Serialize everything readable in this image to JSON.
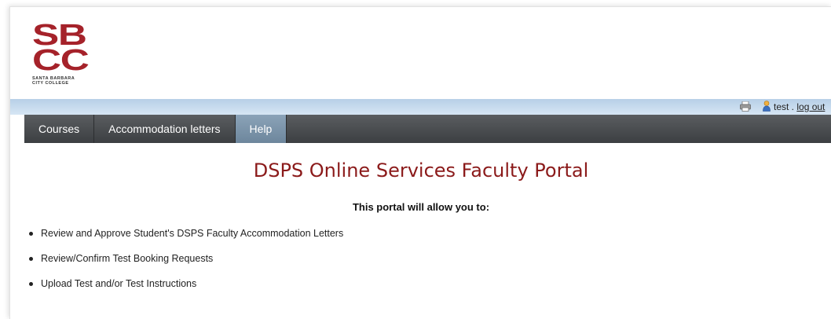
{
  "logo": {
    "line1": "SB",
    "line2": "CC",
    "tagline": "SANTA BARBARA\nCITY COLLEGE",
    "color": "#a5222a"
  },
  "userbar": {
    "print_icon": "printer-icon",
    "user_icon": "user-icon",
    "username": "test",
    "separator": " . ",
    "logout_label": "log out"
  },
  "nav": {
    "items": [
      {
        "label": "Courses",
        "active": false
      },
      {
        "label": "Accommodation letters",
        "active": false
      },
      {
        "label": "Help",
        "active": true
      }
    ]
  },
  "main": {
    "title": "DSPS Online Services Faculty Portal",
    "subtitle": "This portal will allow you to:",
    "features": [
      "Review and Approve Student's DSPS Faculty Accommodation Letters",
      "Review/Confirm Test Booking Requests",
      "Upload Test and/or Test Instructions"
    ]
  },
  "colors": {
    "title": "#8b1a1a",
    "navbar": "#4a4d50",
    "nav_active": "#7b95ab",
    "userbar": "#c6dbef"
  }
}
